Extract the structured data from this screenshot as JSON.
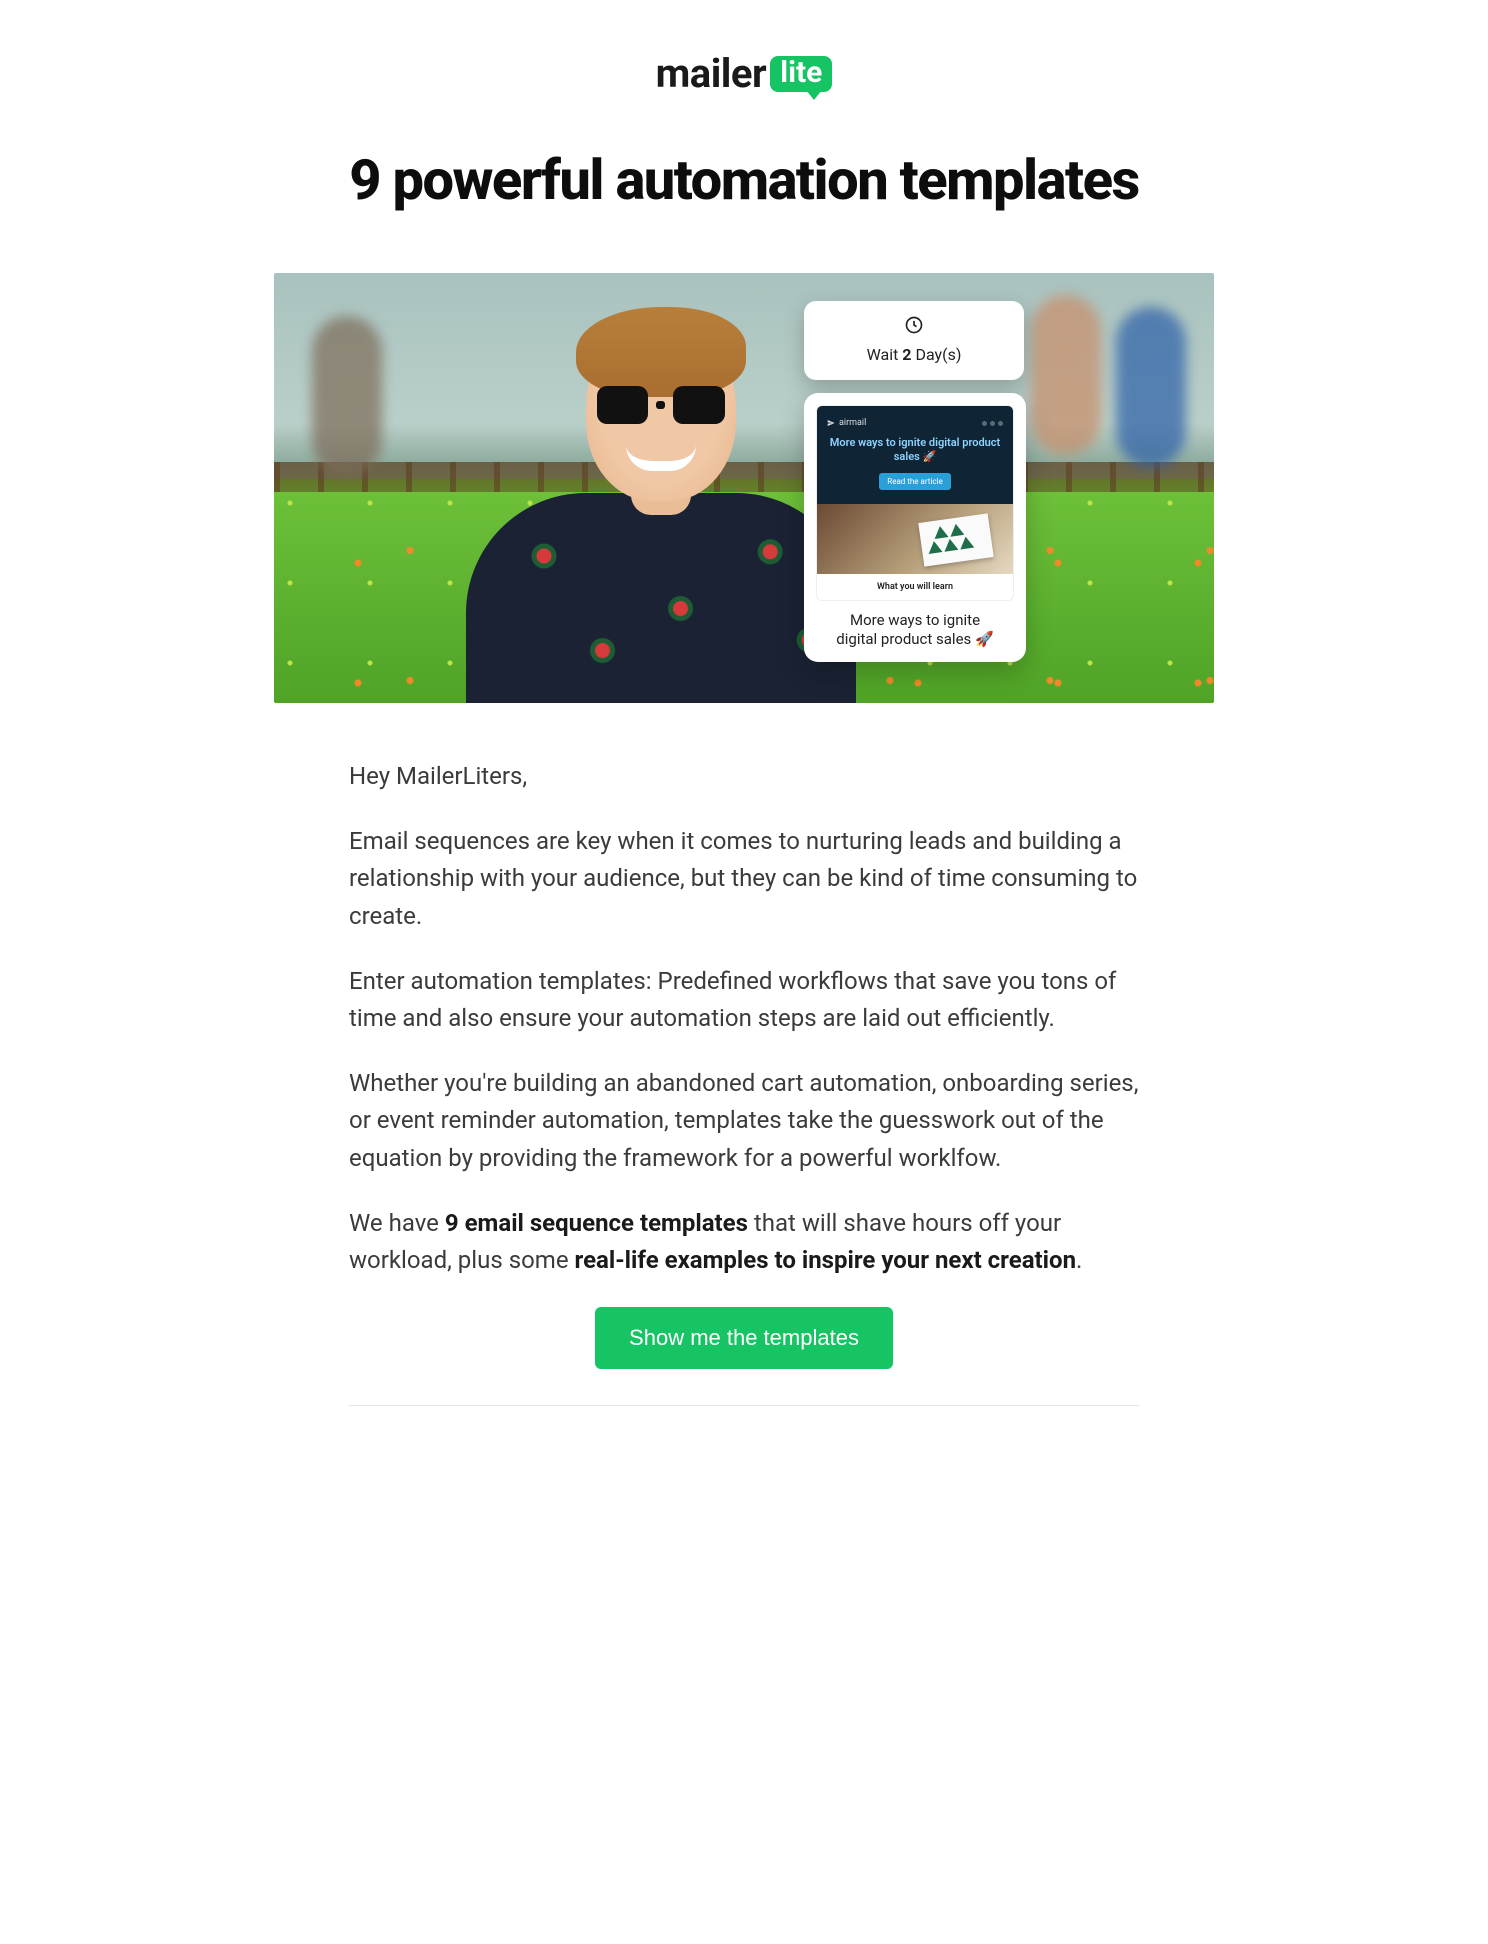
{
  "logo": {
    "part1": "mailer",
    "part2": "lite"
  },
  "title": "9 powerful automation templates",
  "hero": {
    "wait_card": {
      "prefix": "Wait ",
      "days": "2",
      "suffix": " Day(s)"
    },
    "email_card": {
      "brand": "airmail",
      "headline": "More ways to ignite digital product sales 🚀",
      "button": "Read the article",
      "what_you_learn": "What you will learn",
      "caption_line1": "More ways to ignite",
      "caption_line2": "digital product sales 🚀"
    }
  },
  "body": {
    "greeting": "Hey MailerLiters,",
    "p1": "Email sequences are key when it comes to nurturing leads and building a relationship with your audience, but they can be kind of time consuming to create.",
    "p2": "Enter automation templates: Predefined workflows that save you tons of time and also ensure your automation steps are laid out efficiently.",
    "p3": "Whether you're building an abandoned cart automation, onboarding series, or event reminder automation, templates take the guesswork out of the equation by providing the framework for a powerful worklfow.",
    "p4_pre": "We have ",
    "p4_bold1": "9 email sequence templates",
    "p4_mid": " that will shave hours off your workload, plus some ",
    "p4_bold2": "real-life examples to inspire your next creation",
    "p4_post": "."
  },
  "cta": {
    "label": "Show me the templates"
  }
}
